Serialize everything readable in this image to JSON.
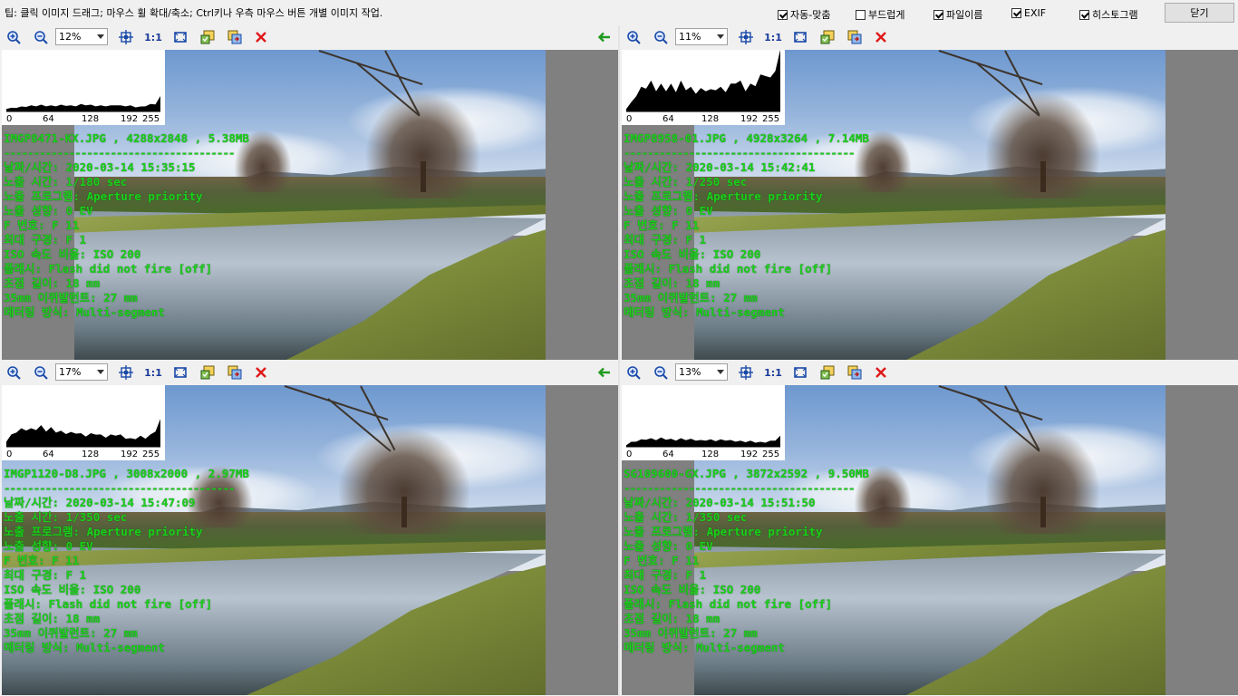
{
  "tip": "팁: 클릭 이미지 드래그; 마우스 휠 확대/축소; Ctrl키나 우측 마우스 버튼 개별 이미지 작업.",
  "options": [
    {
      "label": "자동-맞춤",
      "checked": true
    },
    {
      "label": "부드럽게",
      "checked": false
    },
    {
      "label": "파일이름",
      "checked": true
    },
    {
      "label": "EXIF",
      "checked": true
    },
    {
      "label": "히스토그램",
      "checked": true
    }
  ],
  "close_label": "닫기",
  "toolbar_icons": {
    "zoom_in": "zoom-in-icon",
    "zoom_out": "zoom-out-icon",
    "fit": "fit-icon",
    "actual": "1:1",
    "fullscreen": "fullscreen-icon",
    "save": "save-icon",
    "copy": "copy-icon",
    "close": "close-icon",
    "sync": "sync-arrow-icon"
  },
  "histogram_ticks": [
    "0",
    "64",
    "128",
    "192",
    "255"
  ],
  "separator": "---------------------------------------",
  "exif_labels": {
    "datetime": "날짜/시간",
    "exposure": "노출 시간",
    "program": "노출 프로그램",
    "bias": "노출 성향",
    "fnumber": "F 번호",
    "maxap": "최대 구경",
    "iso": "ISO 속도 비율",
    "flash": "플래시",
    "focal": "초점 길이",
    "focal35": "35mm 이퀴발런트",
    "metering": "메터링 방식"
  },
  "panes": [
    {
      "zoom": "12%",
      "filename_line": "IMGP8471-KX.JPG , 4288x2848 , 5.38MB",
      "datetime": "2020-03-14 15:35:15",
      "exposure": "1/180 sec",
      "program": "Aperture priority",
      "bias": "0 EV",
      "fnumber": "F 11",
      "maxap": "F 1",
      "iso": "ISO 200",
      "flash": "Flash did not fire [off]",
      "focal": "18 mm",
      "focal35": "27 mm",
      "metering": "Multi-segment",
      "has_sync": true
    },
    {
      "zoom": "11%",
      "filename_line": "IMGP8958-01.JPG , 4928x3264 , 7.14MB",
      "datetime": "2020-03-14 15:42:41",
      "exposure": "1/250 sec",
      "program": "Aperture priority",
      "bias": "0 EV",
      "fnumber": "F 11",
      "maxap": "F 1",
      "iso": "ISO 200",
      "flash": "Flash did not fire [off]",
      "focal": "18 mm",
      "focal35": "27 mm",
      "metering": "Multi-segment",
      "has_sync": false
    },
    {
      "zoom": "17%",
      "filename_line": "IMGP1120-D8.JPG , 3008x2000 , 2.97MB",
      "datetime": "2020-03-14 15:47:09",
      "exposure": "1/350 sec",
      "program": "Aperture priority",
      "bias": "0 EV",
      "fnumber": "F 11",
      "maxap": "F 1",
      "iso": "ISO 200",
      "flash": "Flash did not fire [off]",
      "focal": "18 mm",
      "focal35": "27 mm",
      "metering": "Multi-segment",
      "has_sync": true
    },
    {
      "zoom": "13%",
      "filename_line": "SG109600-GX.JPG , 3872x2592 , 9.50MB",
      "datetime": "2020-03-14 15:51:50",
      "exposure": "1/350 sec",
      "program": "Aperture priority",
      "bias": "0 EV",
      "fnumber": "F 11",
      "maxap": "F 1",
      "iso": "ISO 200",
      "flash": "Flash did not fire [off]",
      "focal": "18 mm",
      "focal35": "27 mm",
      "metering": "Multi-segment",
      "has_sync": false
    }
  ]
}
